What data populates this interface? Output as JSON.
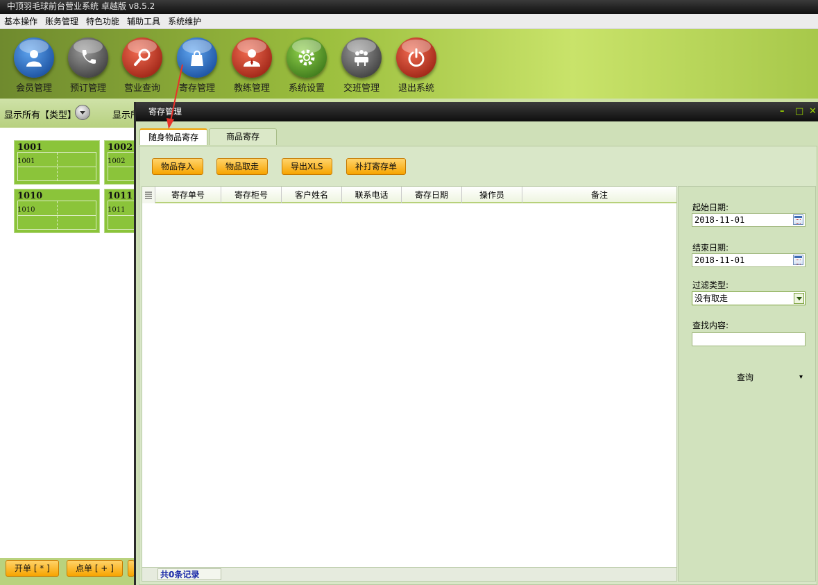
{
  "app": {
    "title": "中顶羽毛球前台营业系统 卓越版 v8.5.2"
  },
  "menu": [
    "基本操作",
    "账务管理",
    "特色功能",
    "辅助工具",
    "系统维护"
  ],
  "toolbar": [
    {
      "label": "会员管理",
      "icon": "member-icon",
      "color": "blue"
    },
    {
      "label": "预订管理",
      "icon": "phone-icon",
      "color": "gray"
    },
    {
      "label": "营业查询",
      "icon": "magnifier-icon",
      "color": "red"
    },
    {
      "label": "寄存管理",
      "icon": "bag-icon",
      "color": "blue"
    },
    {
      "label": "教练管理",
      "icon": "coach-icon",
      "color": "red"
    },
    {
      "label": "系统设置",
      "icon": "gear-icon",
      "color": "green"
    },
    {
      "label": "交班管理",
      "icon": "handover-icon",
      "color": "gray"
    },
    {
      "label": "退出系统",
      "icon": "power-icon",
      "color": "red"
    }
  ],
  "filter": {
    "type_label": "显示所有【类型】",
    "second_label": "显示所"
  },
  "courts": [
    {
      "num": "1001",
      "sub": "1001"
    },
    {
      "num": "1002",
      "sub": "1002"
    },
    {
      "num": "1010",
      "sub": "1010"
    },
    {
      "num": "1011",
      "sub": "1011"
    }
  ],
  "bottom_buttons": [
    "开单 [ * ]",
    "点单 [ + ]"
  ],
  "dialog": {
    "title": "寄存管理",
    "controls": [
      "–",
      "□",
      "✕"
    ],
    "tabs": [
      "随身物品寄存",
      "商品寄存"
    ],
    "active_tab": "随身物品寄存",
    "actions": [
      "物品存入",
      "物品取走",
      "导出XLS",
      "补打寄存单"
    ],
    "columns": [
      "寄存单号",
      "寄存柜号",
      "客户姓名",
      "联系电话",
      "寄存日期",
      "操作员",
      "备注"
    ],
    "rows": [],
    "record_count": "共0条记录",
    "search": {
      "start_label": "起始日期:",
      "start_value": "2018-11-01",
      "end_label": "结束日期:",
      "end_value": "2018-11-01",
      "filter_label": "过滤类型:",
      "filter_value": "没有取走",
      "find_label": "查找内容:",
      "find_value": "",
      "query_label": "查询",
      "query_caret": "▾"
    }
  },
  "colors": {
    "accent_orange": "#f7a400",
    "annotation_arrow": "#e8322a",
    "count_text": "#1a2aa8"
  }
}
